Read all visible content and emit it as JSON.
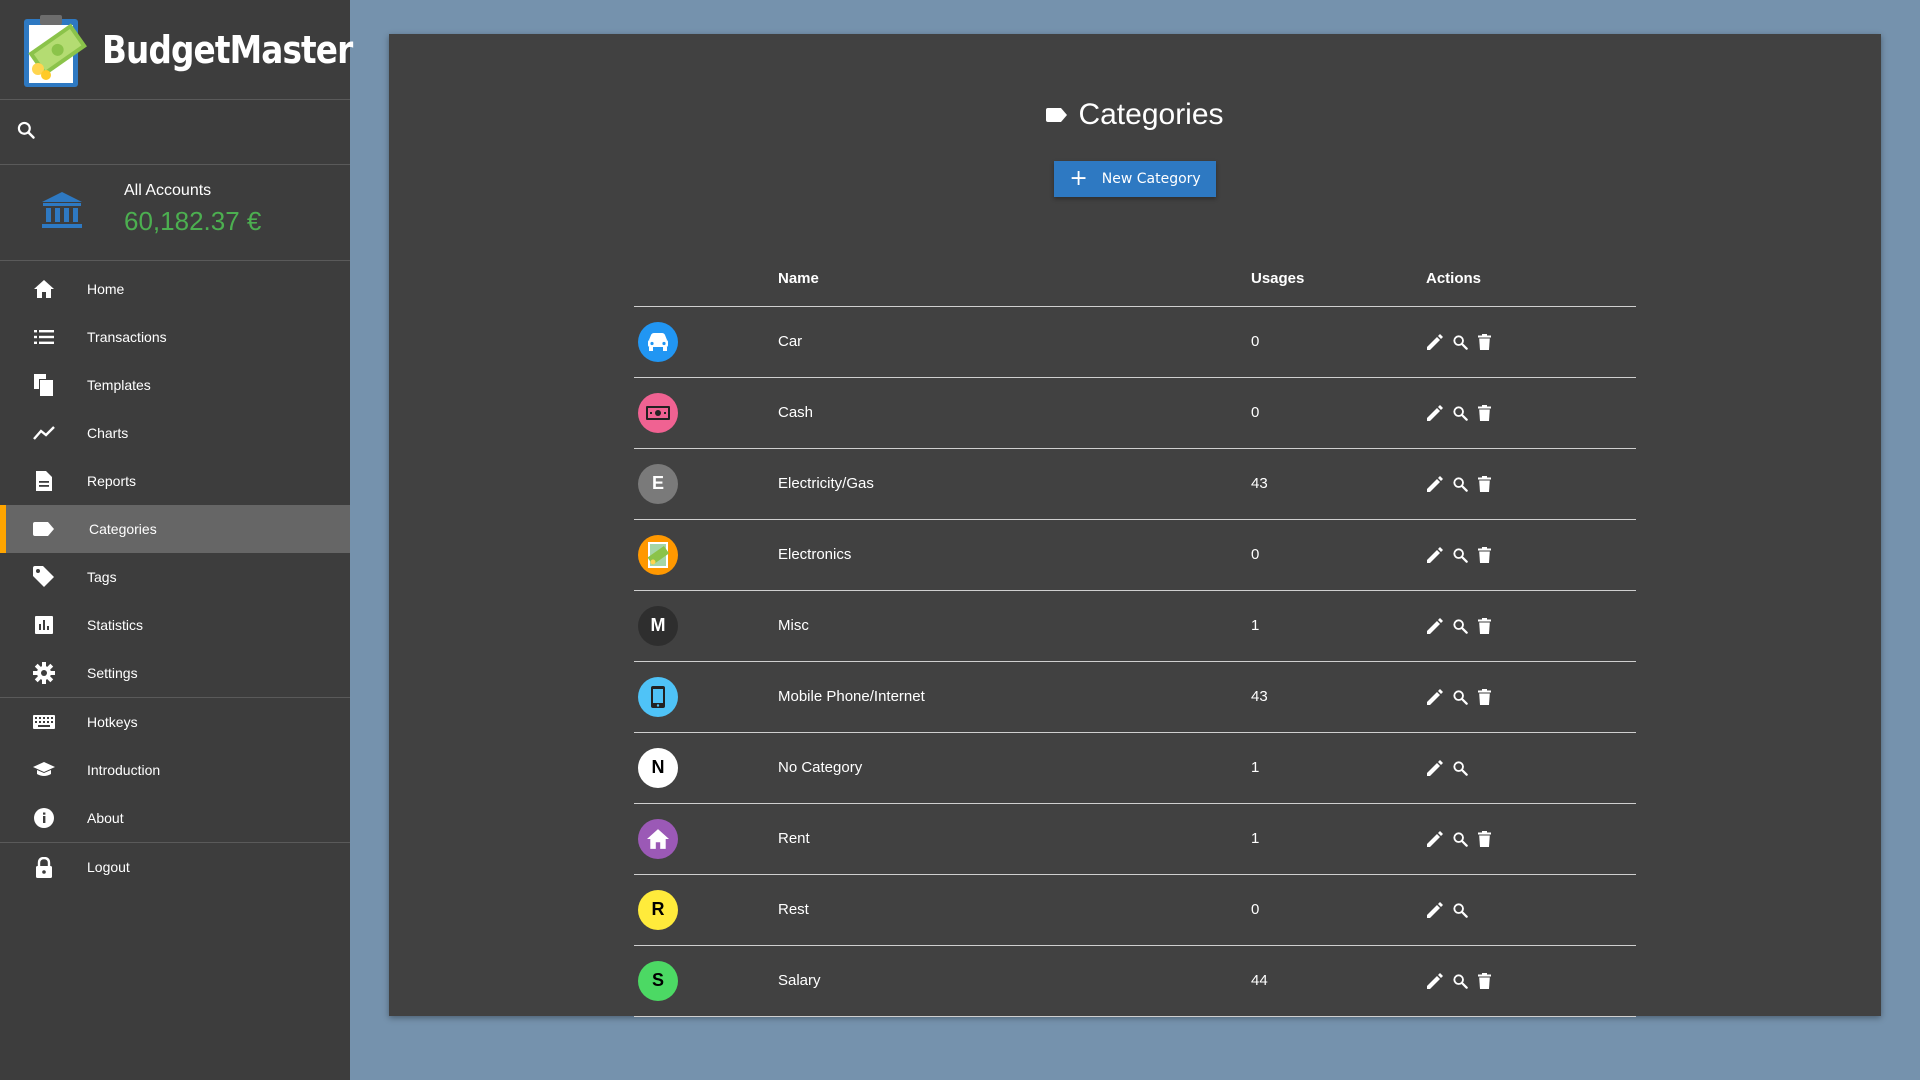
{
  "app": {
    "name": "BudgetMaster"
  },
  "account": {
    "name": "All Accounts",
    "balance": "60,182.37 €"
  },
  "nav": {
    "group1": [
      {
        "label": "Home",
        "icon": "home-icon"
      },
      {
        "label": "Transactions",
        "icon": "list-icon"
      },
      {
        "label": "Templates",
        "icon": "file-copy-icon"
      },
      {
        "label": "Charts",
        "icon": "line-chart-icon"
      },
      {
        "label": "Reports",
        "icon": "report-icon"
      },
      {
        "label": "Categories",
        "icon": "label-icon",
        "active": true
      },
      {
        "label": "Tags",
        "icon": "tag-icon"
      },
      {
        "label": "Statistics",
        "icon": "bar-chart-icon"
      },
      {
        "label": "Settings",
        "icon": "gear-icon"
      }
    ],
    "group2": [
      {
        "label": "Hotkeys",
        "icon": "keyboard-icon"
      },
      {
        "label": "Introduction",
        "icon": "school-icon"
      },
      {
        "label": "About",
        "icon": "info-icon"
      }
    ],
    "group3": [
      {
        "label": "Logout",
        "icon": "lock-icon"
      }
    ]
  },
  "main": {
    "title": "Categories",
    "new_button_label": "New Category",
    "columns": {
      "name": "Name",
      "usages": "Usages",
      "actions": "Actions"
    },
    "categories": [
      {
        "name": "Car",
        "usages": "0",
        "color": "#2196f3",
        "icon": "car-icon",
        "letter": "",
        "fg": "#ffffff",
        "deletable": true
      },
      {
        "name": "Cash",
        "usages": "0",
        "color": "#f06292",
        "icon": "money-icon",
        "letter": "",
        "fg": "#ffffff",
        "deletable": true
      },
      {
        "name": "Electricity/Gas",
        "usages": "43",
        "color": "#7a7a7a",
        "icon": "",
        "letter": "E",
        "fg": "#ffffff",
        "deletable": true
      },
      {
        "name": "Electronics",
        "usages": "0",
        "color": "#ff9800",
        "icon": "electronics-image-icon",
        "letter": "",
        "fg": "#ffffff",
        "deletable": true
      },
      {
        "name": "Misc",
        "usages": "1",
        "color": "#2e2e2e",
        "icon": "",
        "letter": "M",
        "fg": "#ffffff",
        "deletable": true
      },
      {
        "name": "Mobile Phone/Internet",
        "usages": "43",
        "color": "#4fc3f7",
        "icon": "phone-icon",
        "letter": "",
        "fg": "#ffffff",
        "deletable": true
      },
      {
        "name": "No Category",
        "usages": "1",
        "color": "#ffffff",
        "icon": "",
        "letter": "N",
        "fg": "#000000",
        "deletable": false
      },
      {
        "name": "Rent",
        "usages": "1",
        "color": "#9b59b6",
        "icon": "home-icon",
        "letter": "",
        "fg": "#ffffff",
        "deletable": true
      },
      {
        "name": "Rest",
        "usages": "0",
        "color": "#ffeb3b",
        "icon": "",
        "letter": "R",
        "fg": "#000000",
        "deletable": false
      },
      {
        "name": "Salary",
        "usages": "44",
        "color": "#4cd964",
        "icon": "",
        "letter": "S",
        "fg": "#000000",
        "deletable": true
      }
    ]
  }
}
